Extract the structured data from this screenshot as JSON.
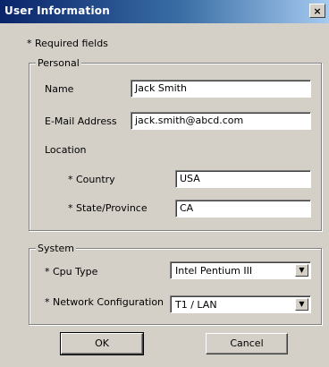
{
  "window": {
    "title": "User Information",
    "close_glyph": "×"
  },
  "required_note": "* Required fields",
  "personal": {
    "group_label": "Personal",
    "name_label": "Name",
    "name_value": "Jack Smith",
    "email_label": "E-Mail Address",
    "email_value": "jack.smith@abcd.com",
    "location_label": "Location",
    "country_label": "* Country",
    "country_value": "USA",
    "state_label": "* State/Province",
    "state_value": "CA"
  },
  "system": {
    "group_label": "System",
    "cpu_label": "* Cpu Type",
    "cpu_value": "Intel Pentium III",
    "network_label": "* Network Configuration",
    "network_value": "T1 / LAN"
  },
  "buttons": {
    "ok": "OK",
    "cancel": "Cancel"
  },
  "icons": {
    "dropdown": "▼"
  }
}
